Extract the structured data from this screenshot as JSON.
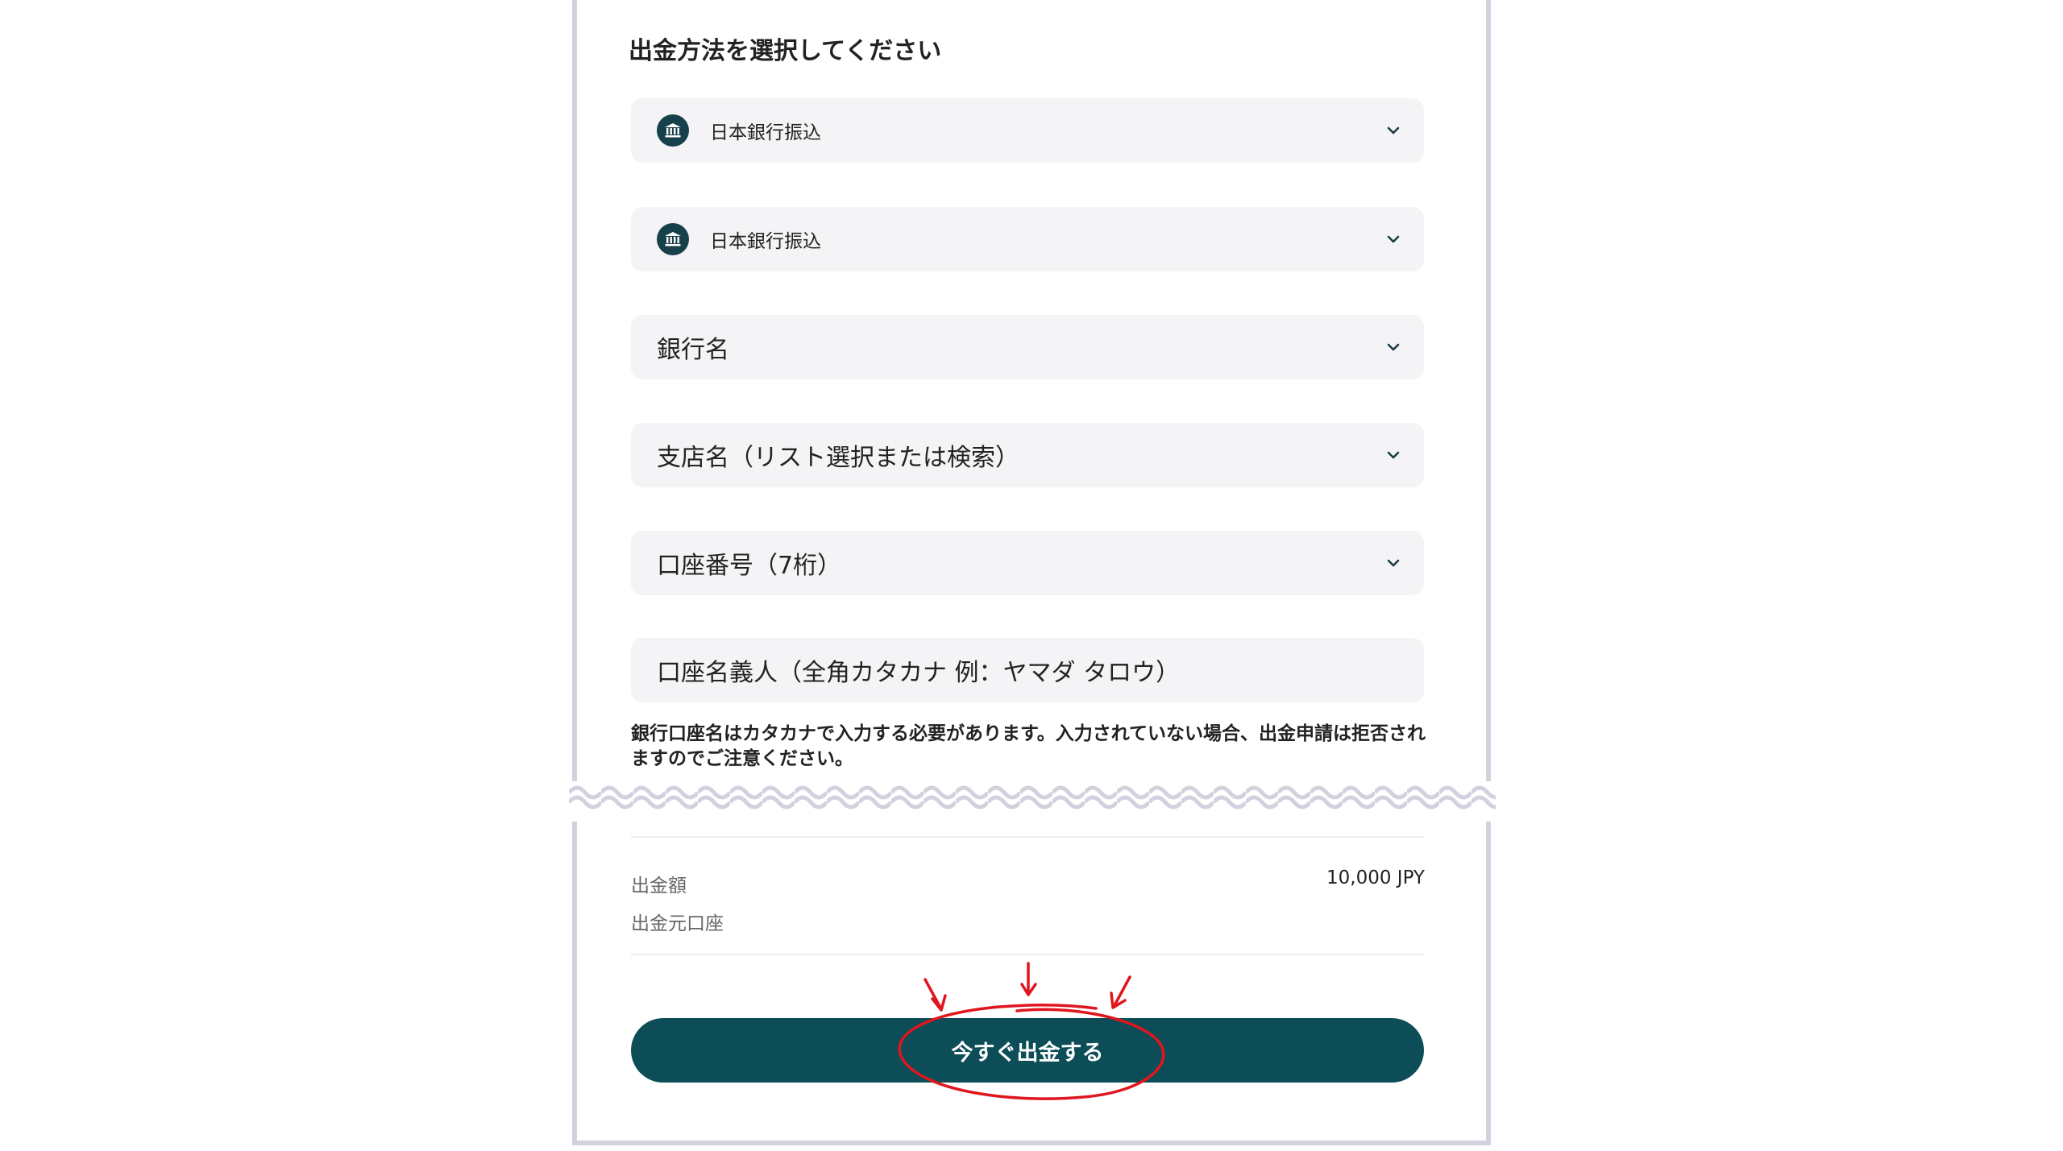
{
  "page": {
    "title": "出金方法を選択してください"
  },
  "fields": [
    {
      "label": "日本銀行振込",
      "icon": "bank-icon"
    },
    {
      "label": "日本銀行振込",
      "icon": "bank-icon"
    },
    {
      "label": "銀行名"
    },
    {
      "label": "支店名（リスト選択または検索）"
    },
    {
      "label": "口座番号（7桁）"
    },
    {
      "placeholder": "口座名義人（全角カタカナ 例：ヤマダ タロウ）"
    }
  ],
  "notice": "銀行口座名はカタカナで入力する必要があります。入力されていない場合、出金申請は拒否されますのでご注意ください。",
  "summary": {
    "amount_label": "出金額",
    "amount_value": "10,000 JPY",
    "source_label": "出金元口座"
  },
  "submit": {
    "label": "今すぐ出金する"
  },
  "colors": {
    "accent": "#0c4d57",
    "icon_bg": "#17414a",
    "field_bg": "#f4f4f6",
    "annotation": "#e0161e"
  }
}
